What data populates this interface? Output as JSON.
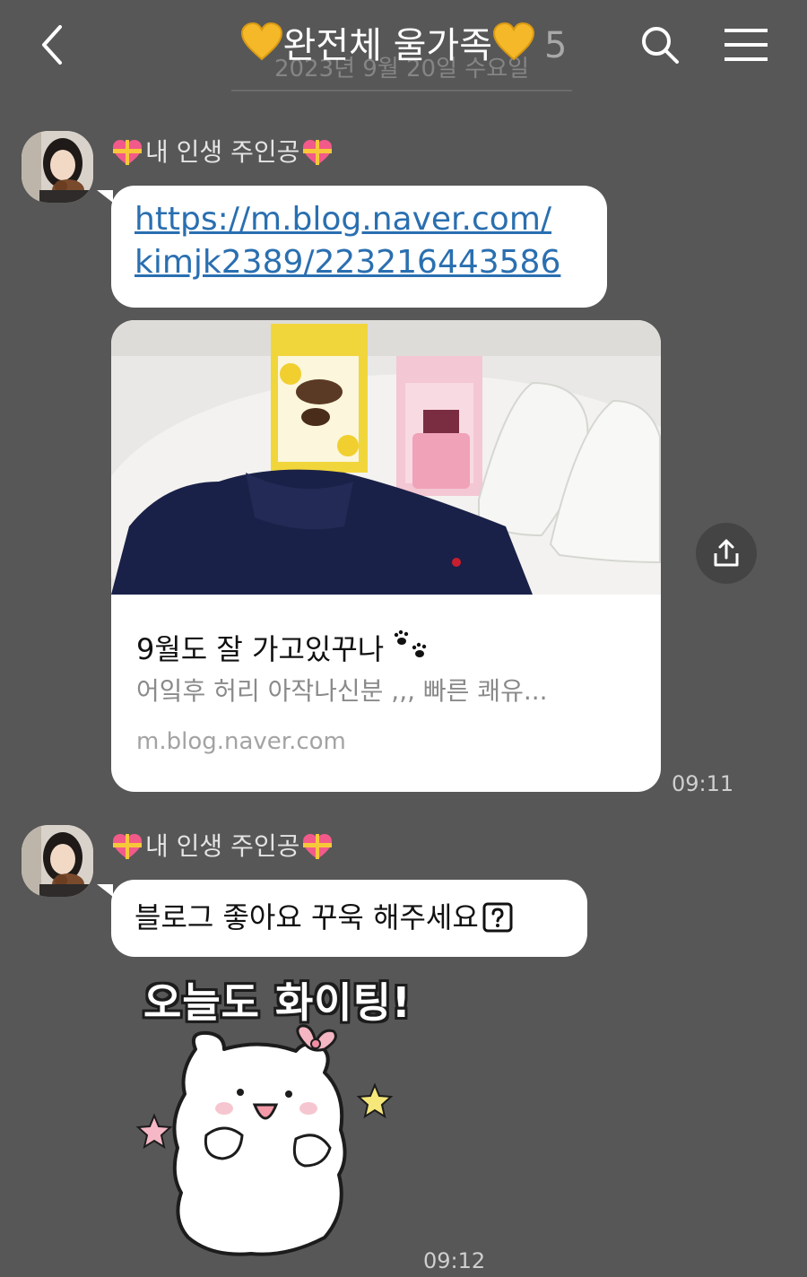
{
  "header": {
    "title": "완전체 울가족",
    "member_count": "5",
    "date_overlay": "2023년 9월 20일 수요일"
  },
  "messages": [
    {
      "sender": "내 인생 주인공",
      "link_line1": "https://m.blog.naver.com/",
      "link_line2": "kimjk2389/223216443586",
      "card": {
        "title": "9월도 잘 가고있꾸나",
        "description": "어잌후 허리 아작나신분 ,,, 빠른 쾌유...",
        "domain": "m.blog.naver.com"
      },
      "time": "09:11"
    },
    {
      "sender": "내 인생 주인공",
      "text": "블로그 좋아요 꾸욱 해주세요",
      "sticker_text": "오늘도 화이팅!",
      "time": "09:12"
    }
  ],
  "icons": {
    "back": "chevron-left-icon",
    "search": "search-icon",
    "menu": "menu-icon",
    "share": "share-icon",
    "heart": "yellow-heart-icon",
    "gift_heart": "gift-heart-icon",
    "paw": "paw-prints-icon",
    "question": "question-box-icon"
  },
  "colors": {
    "background": "#575757",
    "bubble": "#ffffff",
    "link": "#2a6fb0",
    "heart_yellow": "#f4b829",
    "gift_heart_pink": "#f25a8a"
  }
}
